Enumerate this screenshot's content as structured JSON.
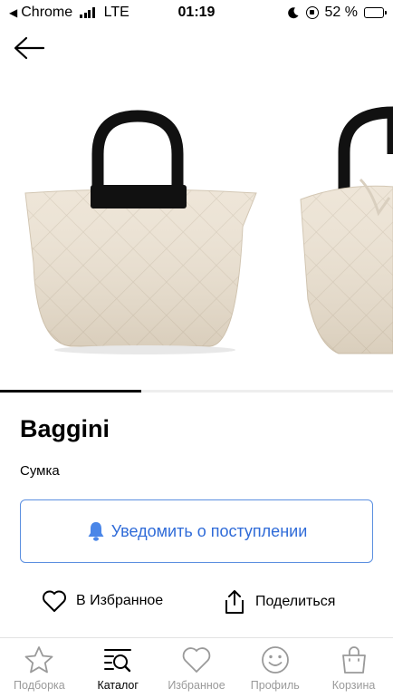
{
  "status_bar": {
    "back_app": "Chrome",
    "network": "LTE",
    "time": "01:19",
    "battery": "52 %",
    "battery_level": 0.52
  },
  "gallery": {
    "progress": 0.36
  },
  "product": {
    "brand": "Baggini",
    "type": "Сумка"
  },
  "notify_button": {
    "label": "Уведомить о поступлении"
  },
  "actions": {
    "favorite_label": "В Избранное",
    "share_label": "Поделиться"
  },
  "tabbar": {
    "items": [
      {
        "label": "Подборка",
        "icon": "star-icon",
        "active": false
      },
      {
        "label": "Каталог",
        "icon": "catalog-search-icon",
        "active": true
      },
      {
        "label": "Избранное",
        "icon": "heart-icon",
        "active": false
      },
      {
        "label": "Профиль",
        "icon": "smile-icon",
        "active": false
      },
      {
        "label": "Корзина",
        "icon": "bag-icon",
        "active": false
      }
    ]
  },
  "colors": {
    "accent": "#2f6bd8",
    "border_accent": "#5b8fe0",
    "tab_inactive": "#9a9a9a",
    "bag_cream": "#ece2d2",
    "handle_black": "#111111"
  }
}
